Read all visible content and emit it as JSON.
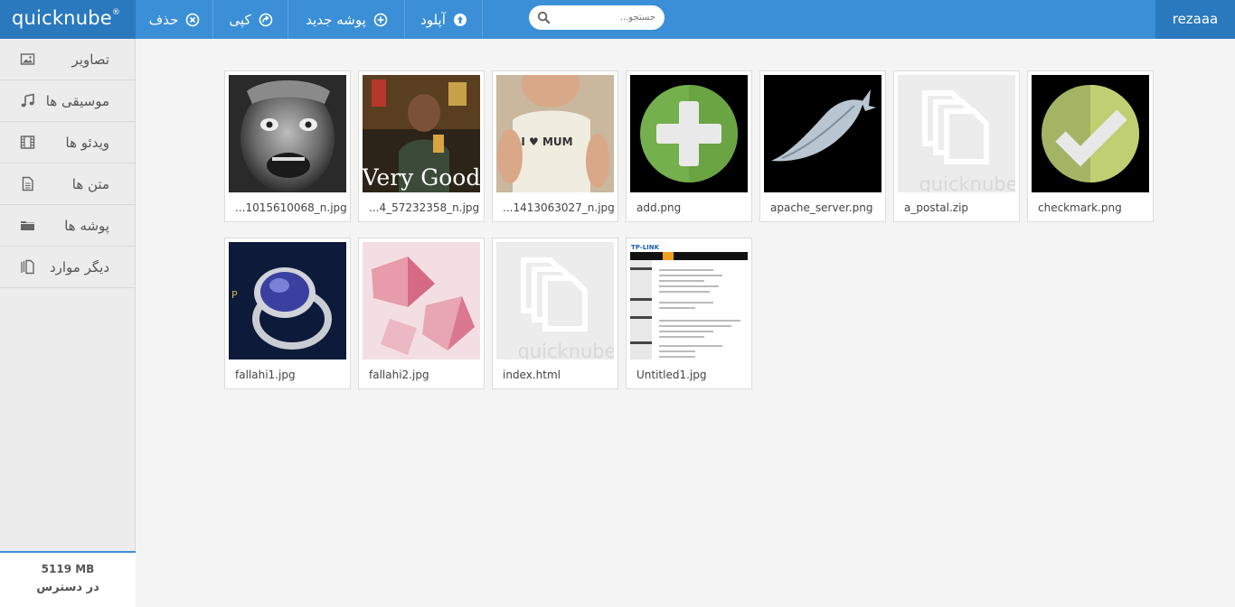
{
  "app": {
    "logo": "quicknube",
    "logo_mark": "®",
    "user": "rezaaa"
  },
  "toolbar": {
    "delete_label": "حذف",
    "copy_label": "کپی",
    "new_folder_label": "پوشه جدید",
    "upload_label": "آپلود"
  },
  "search": {
    "placeholder": "جستجو..."
  },
  "sidebar": {
    "items": [
      {
        "label": "تصاویر",
        "icon": "image-icon"
      },
      {
        "label": "موسیقی ها",
        "icon": "music-icon"
      },
      {
        "label": "ویدئو ها",
        "icon": "film-icon"
      },
      {
        "label": "متن ها",
        "icon": "document-icon"
      },
      {
        "label": "پوشه ها",
        "icon": "folder-icon"
      },
      {
        "label": "دیگر موارد",
        "icon": "files-icon"
      }
    ],
    "storage_size": "5119 MB",
    "storage_label": "در دسترس"
  },
  "files": [
    {
      "name": "...1015610068_n.jpg",
      "thumb": "bw-laughing-man-photo"
    },
    {
      "name": "...4_57232358_n.jpg",
      "thumb": "very-good-meme-photo",
      "caption": "Very Good"
    },
    {
      "name": "...1413063027_n.jpg",
      "thumb": "baby-shirt-photo",
      "caption": "I ♥ MUM"
    },
    {
      "name": "add.png",
      "thumb": "add-icon"
    },
    {
      "name": "apache_server.png",
      "thumb": "apache-feather-icon"
    },
    {
      "name": "a_postal.zip",
      "thumb": "quicknube-placeholder",
      "caption": "quicknube"
    },
    {
      "name": "checkmark.png",
      "thumb": "checkmark-icon"
    },
    {
      "name": "fallahi1.jpg",
      "thumb": "sapphire-ring-photo"
    },
    {
      "name": "fallahi2.jpg",
      "thumb": "pink-gem-photo"
    },
    {
      "name": "index.html",
      "thumb": "quicknube-placeholder",
      "caption": "quicknube"
    },
    {
      "name": "Untitled1.jpg",
      "thumb": "tplink-screenshot",
      "caption": "TP-LINK"
    }
  ],
  "colors": {
    "topbar": "#3b8fd6",
    "topbar_dark": "#2a79bf",
    "background": "#f4f4f4",
    "sidebar": "#ececec"
  }
}
